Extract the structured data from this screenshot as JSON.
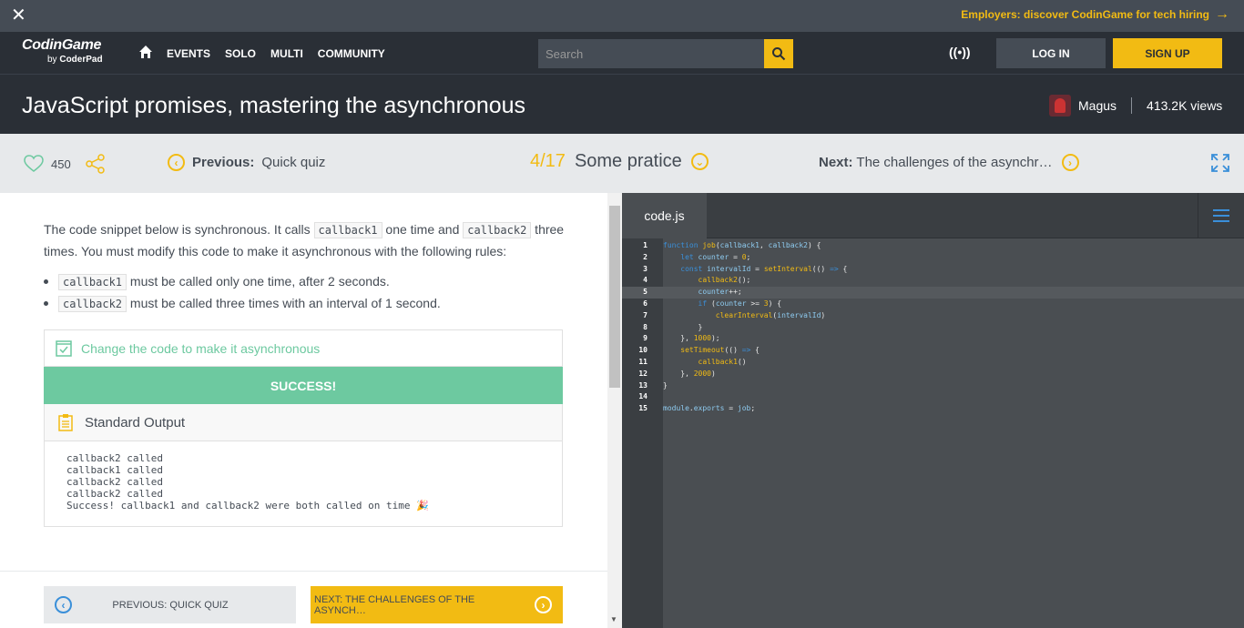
{
  "banner": {
    "close_label": "✕",
    "promo_text": "Employers: discover CodinGame for tech hiring",
    "arrow": "→"
  },
  "nav": {
    "logo_main": "CodinGame",
    "logo_sub_prefix": "by",
    "logo_sub_brand": "CoderPad",
    "menu": [
      "EVENTS",
      "SOLO",
      "MULTI",
      "COMMUNITY"
    ],
    "search_placeholder": "Search",
    "radio_label": "((•))",
    "login": "LOG IN",
    "signup": "SIGN UP"
  },
  "page": {
    "title": "JavaScript promises, mastering the asynchronous",
    "author": "Magus",
    "views": "413.2K views"
  },
  "lesson_nav": {
    "likes": "450",
    "prev_label": "Previous:",
    "prev_title": "Quick quiz",
    "position": "4/17",
    "current_title": "Some pratice",
    "next_label": "Next:",
    "next_title": "The challenges of the asynchr…"
  },
  "content": {
    "intro_1": "The code snippet below is synchronous. It calls ",
    "code_cb1": "callback1",
    "intro_2": " one time and ",
    "code_cb2": "callback2",
    "intro_3": " three times. You must modify this code to make it asynchronous with the following rules:",
    "bullet_1_text": " must be called only one time, after 2 seconds.",
    "bullet_2_text": " must be called three times with an interval of 1 second.",
    "task_label": "Change the code to make it asynchronous",
    "success_label": "SUCCESS!",
    "output_header": "Standard Output",
    "output_lines": [
      "callback2 called",
      "callback1 called",
      "callback2 called",
      "callback2 called",
      "Success! callback1 and callback2 were both called on time 🎉"
    ],
    "btn_prev": "PREVIOUS: QUICK QUIZ",
    "btn_next": "NEXT: THE CHALLENGES OF THE ASYNCH…"
  },
  "editor": {
    "tab": "code.js",
    "line_numbers": [
      "1",
      "2",
      "3",
      "4",
      "5",
      "6",
      "7",
      "8",
      "9",
      "10",
      "11",
      "12",
      "13",
      "14",
      "15"
    ]
  },
  "colors": {
    "accent": "#f2bb13",
    "success": "#6dc9a0",
    "dark": "#2a2f36",
    "link": "#3a8fd9"
  }
}
